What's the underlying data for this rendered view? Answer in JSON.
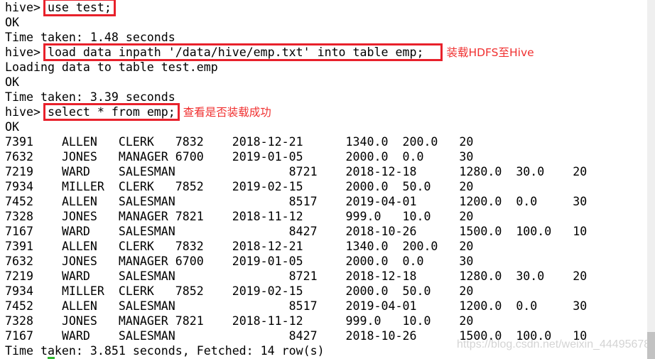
{
  "prompt": "hive> ",
  "cmd1": "use test;",
  "ok": "OK",
  "time1": "Time taken: 1.48 seconds",
  "cmd2": "load data inpath '/data/hive/emp.txt' into table emp;",
  "note2": "装载HDFS至Hive",
  "loading": "Loading data to table test.emp",
  "time2": "Time taken: 3.39 seconds",
  "cmd3": "select * from emp;",
  "note3": "查看是否装载成功",
  "rows": [
    [
      "7391",
      "ALLEN",
      "CLERK",
      "7832",
      "2018-12-21",
      "1340.0",
      "200.0",
      "20"
    ],
    [
      "7632",
      "JONES",
      "MANAGER",
      "6700",
      "2019-01-05",
      "2000.0",
      "0.0",
      "30"
    ],
    [
      "7219",
      "WARD",
      "SALESMAN",
      "",
      "8721",
      "2018-12-18",
      "1280.0",
      "30.0",
      "20"
    ],
    [
      "7934",
      "MILLER",
      "CLERK",
      "7852",
      "2019-02-15",
      "2000.0",
      "50.0",
      "20"
    ],
    [
      "7452",
      "ALLEN",
      "SALESMAN",
      "",
      "8517",
      "2019-04-01",
      "1200.0",
      "0.0",
      "30"
    ],
    [
      "7328",
      "JONES",
      "MANAGER",
      "7821",
      "2018-11-12",
      "999.0",
      "10.0",
      "20"
    ],
    [
      "7167",
      "WARD",
      "SALESMAN",
      "",
      "8427",
      "2018-10-26",
      "1500.0",
      "100.0",
      "10"
    ],
    [
      "7391",
      "ALLEN",
      "CLERK",
      "7832",
      "2018-12-21",
      "1340.0",
      "200.0",
      "20"
    ],
    [
      "7632",
      "JONES",
      "MANAGER",
      "6700",
      "2019-01-05",
      "2000.0",
      "0.0",
      "30"
    ],
    [
      "7219",
      "WARD",
      "SALESMAN",
      "",
      "8721",
      "2018-12-18",
      "1280.0",
      "30.0",
      "20"
    ],
    [
      "7934",
      "MILLER",
      "CLERK",
      "7852",
      "2019-02-15",
      "2000.0",
      "50.0",
      "20"
    ],
    [
      "7452",
      "ALLEN",
      "SALESMAN",
      "",
      "8517",
      "2019-04-01",
      "1200.0",
      "0.0",
      "30"
    ],
    [
      "7328",
      "JONES",
      "MANAGER",
      "7821",
      "2018-11-12",
      "999.0",
      "10.0",
      "20"
    ],
    [
      "7167",
      "WARD",
      "SALESMAN",
      "",
      "8427",
      "2018-10-26",
      "1500.0",
      "100.0",
      "10"
    ]
  ],
  "time3": "Time taken: 3.851 seconds, Fetched: 14 row(s)",
  "watermark": "https://blog.csdn.net/weixin_44495678",
  "colors": {
    "highlight": "#e8212b",
    "annotation": "#f03030",
    "cursor": "#2fb82f"
  }
}
